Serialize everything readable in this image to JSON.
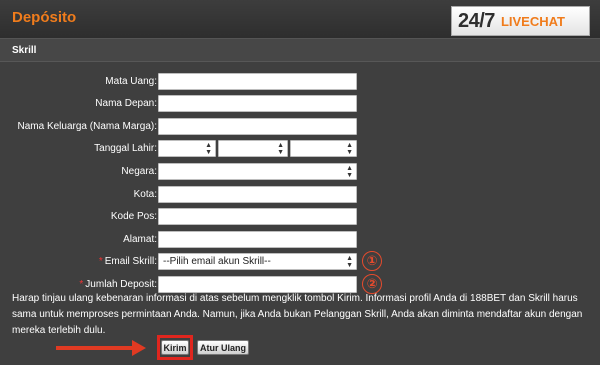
{
  "header": {
    "title": "Depósito",
    "livechat": {
      "prefix": "24/7",
      "label": "LIVECHAT"
    }
  },
  "section": {
    "title": "Skrill"
  },
  "form": {
    "mata_uang": {
      "label": "Mata Uang:",
      "value": ""
    },
    "nama_depan": {
      "label": "Nama Depan:",
      "value": ""
    },
    "nama_keluarga": {
      "label": "Nama Keluarga (Nama Marga):",
      "value": ""
    },
    "tanggal_lahir": {
      "label": "Tanggal Lahir:",
      "day": "",
      "month": "",
      "year": ""
    },
    "negara": {
      "label": "Negara:",
      "value": ""
    },
    "kota": {
      "label": "Kota:",
      "value": ""
    },
    "kode_pos": {
      "label": "Kode Pos:",
      "value": ""
    },
    "alamat": {
      "label": "Alamat:",
      "value": ""
    },
    "email_skrill": {
      "required_mark": "*",
      "label": "Email Skrill:",
      "value": "--Pilih email akun Skrill--"
    },
    "jumlah_deposit": {
      "required_mark": "*",
      "label": "Jumlah Deposit:",
      "value": ""
    }
  },
  "markers": {
    "one": "①",
    "two": "②"
  },
  "notice": "Harap tinjau ulang kebenaran informasi di atas sebelum mengklik tombol Kirim. Informasi profil Anda di 188BET dan Skrill harus sama untuk memproses permintaan Anda. Namun, jika Anda bukan Pelanggan Skrill, Anda akan diminta mendaftar akun dengan mereka terlebih dulu.",
  "buttons": {
    "submit": "Kirim",
    "reset": "Atur Ulang"
  },
  "colors": {
    "accent": "#f07c1c",
    "annotation": "#e0261e",
    "background": "#3f3f3f"
  },
  "icons": {
    "select_arrow": "up-down-arrows-icon",
    "pointer": "arrow-right-icon"
  }
}
